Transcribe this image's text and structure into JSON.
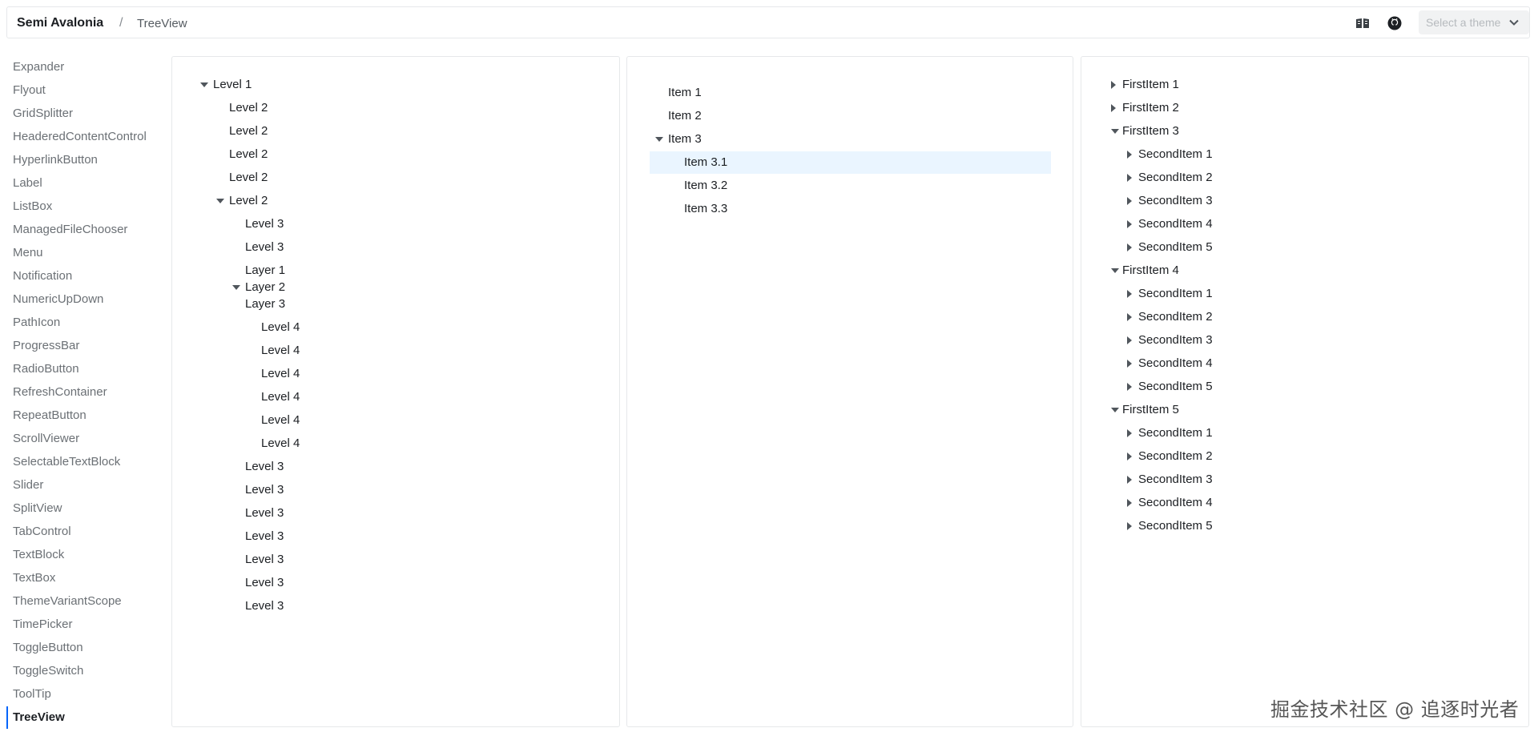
{
  "header": {
    "brand": "Semi Avalonia",
    "separator": "/",
    "breadcrumb": "TreeView",
    "theme_select_placeholder": "Select a theme"
  },
  "sidebar": {
    "items": [
      "Expander",
      "Flyout",
      "GridSplitter",
      "HeaderedContentControl",
      "HyperlinkButton",
      "Label",
      "ListBox",
      "ManagedFileChooser",
      "Menu",
      "Notification",
      "NumericUpDown",
      "PathIcon",
      "ProgressBar",
      "RadioButton",
      "RefreshContainer",
      "RepeatButton",
      "ScrollViewer",
      "SelectableTextBlock",
      "Slider",
      "SplitView",
      "TabControl",
      "TextBlock",
      "TextBox",
      "ThemeVariantScope",
      "TimePicker",
      "ToggleButton",
      "ToggleSwitch",
      "ToolTip",
      "TreeView"
    ],
    "active": "TreeView"
  },
  "tree1": {
    "nodes": [
      {
        "label": "Level 1",
        "caret": "down",
        "depth": 0
      },
      {
        "label": "Level 2",
        "caret": "none",
        "depth": 1
      },
      {
        "label": "Level 2",
        "caret": "none",
        "depth": 1
      },
      {
        "label": "Level 2",
        "caret": "none",
        "depth": 1
      },
      {
        "label": "Level 2",
        "caret": "none",
        "depth": 1
      },
      {
        "label": "Level 2",
        "caret": "down",
        "depth": 1
      },
      {
        "label": "Level 3",
        "caret": "none",
        "depth": 2
      },
      {
        "label": "Level 3",
        "caret": "none",
        "depth": 2
      },
      {
        "label": "Layer 1",
        "caret": "none",
        "depth": 2
      },
      {
        "label": "Layer 2",
        "caret": "down",
        "depth": 2
      },
      {
        "label": "Layer 3",
        "caret": "none",
        "depth": 2
      },
      {
        "label": "Level 4",
        "caret": "none",
        "depth": 3
      },
      {
        "label": "Level 4",
        "caret": "none",
        "depth": 3
      },
      {
        "label": "Level 4",
        "caret": "none",
        "depth": 3
      },
      {
        "label": "Level 4",
        "caret": "none",
        "depth": 3
      },
      {
        "label": "Level 4",
        "caret": "none",
        "depth": 3
      },
      {
        "label": "Level 4",
        "caret": "none",
        "depth": 3
      },
      {
        "label": "Level 3",
        "caret": "none",
        "depth": 2
      },
      {
        "label": "Level 3",
        "caret": "none",
        "depth": 2
      },
      {
        "label": "Level 3",
        "caret": "none",
        "depth": 2
      },
      {
        "label": "Level 3",
        "caret": "none",
        "depth": 2
      },
      {
        "label": "Level 3",
        "caret": "none",
        "depth": 2
      },
      {
        "label": "Level 3",
        "caret": "none",
        "depth": 2
      },
      {
        "label": "Level 3",
        "caret": "none",
        "depth": 2
      }
    ]
  },
  "tree2": {
    "nodes": [
      {
        "label": "Item 1",
        "caret": "none",
        "depth": 0,
        "selected": false
      },
      {
        "label": "Item 2",
        "caret": "none",
        "depth": 0,
        "selected": false
      },
      {
        "label": "Item 3",
        "caret": "down",
        "depth": 0,
        "selected": false
      },
      {
        "label": "Item 3.1",
        "caret": "none",
        "depth": 1,
        "selected": true
      },
      {
        "label": "Item 3.2",
        "caret": "none",
        "depth": 1,
        "selected": false
      },
      {
        "label": "Item 3.3",
        "caret": "none",
        "depth": 1,
        "selected": false
      }
    ]
  },
  "tree3": {
    "nodes": [
      {
        "label": "FirstItem 1",
        "caret": "right",
        "depth": 0
      },
      {
        "label": "FirstItem 2",
        "caret": "right",
        "depth": 0
      },
      {
        "label": "FirstItem 3",
        "caret": "down",
        "depth": 0
      },
      {
        "label": "SecondItem 1",
        "caret": "right",
        "depth": 1
      },
      {
        "label": "SecondItem 2",
        "caret": "right",
        "depth": 1
      },
      {
        "label": "SecondItem 3",
        "caret": "right",
        "depth": 1
      },
      {
        "label": "SecondItem 4",
        "caret": "right",
        "depth": 1
      },
      {
        "label": "SecondItem 5",
        "caret": "right",
        "depth": 1
      },
      {
        "label": "FirstItem 4",
        "caret": "down",
        "depth": 0
      },
      {
        "label": "SecondItem 1",
        "caret": "right",
        "depth": 1
      },
      {
        "label": "SecondItem 2",
        "caret": "right",
        "depth": 1
      },
      {
        "label": "SecondItem 3",
        "caret": "right",
        "depth": 1
      },
      {
        "label": "SecondItem 4",
        "caret": "right",
        "depth": 1
      },
      {
        "label": "SecondItem 5",
        "caret": "right",
        "depth": 1
      },
      {
        "label": "FirstItem 5",
        "caret": "down",
        "depth": 0
      },
      {
        "label": "SecondItem 1",
        "caret": "right",
        "depth": 1
      },
      {
        "label": "SecondItem 2",
        "caret": "right",
        "depth": 1
      },
      {
        "label": "SecondItem 3",
        "caret": "right",
        "depth": 1
      },
      {
        "label": "SecondItem 4",
        "caret": "right",
        "depth": 1
      },
      {
        "label": "SecondItem 5",
        "caret": "right",
        "depth": 1
      }
    ]
  },
  "watermark": "掘金技术社区 @ 追逐时光者",
  "colors": {
    "accent": "#0064fa",
    "selected_bg": "#eaf5ff",
    "border": "#e6e8ea",
    "sidebar_text": "#6b7075"
  }
}
